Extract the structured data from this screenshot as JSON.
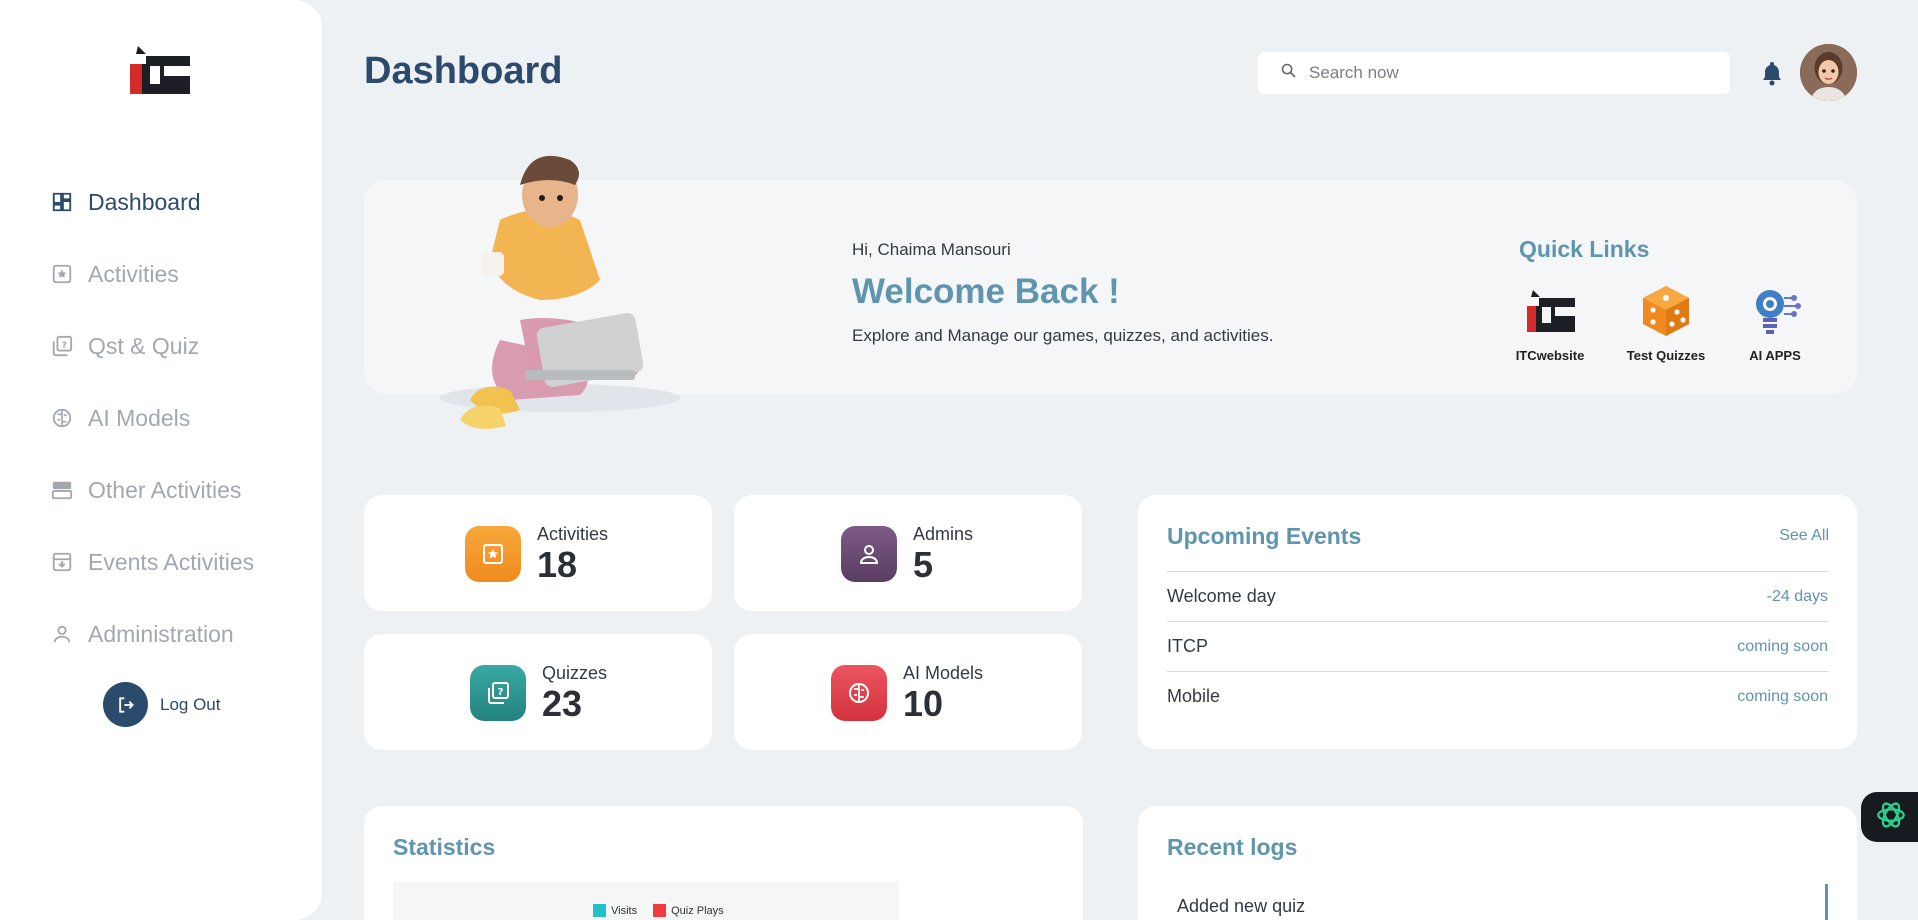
{
  "sidebar": {
    "items": [
      {
        "label": "Dashboard",
        "icon": "dashboard-icon",
        "active": true
      },
      {
        "label": "Activities",
        "icon": "star-box-icon"
      },
      {
        "label": "Qst & Quiz",
        "icon": "quiz-icon"
      },
      {
        "label": "AI Models",
        "icon": "brain-icon"
      },
      {
        "label": "Other Activities",
        "icon": "panels-icon"
      },
      {
        "label": "Events Activities",
        "icon": "archive-icon"
      },
      {
        "label": "Administration",
        "icon": "person-icon"
      }
    ],
    "logout_label": "Log Out"
  },
  "header": {
    "title": "Dashboard",
    "search_placeholder": "Search now"
  },
  "banner": {
    "greeting": "Hi, Chaima Mansouri",
    "welcome": "Welcome Back !",
    "subtitle": "Explore and Manage our games, quizzes, and activities.",
    "quick_links_title": "Quick Links",
    "quick_links": [
      {
        "label": "ITCwebsite",
        "icon": "itc-logo-icon"
      },
      {
        "label": "Test Quizzes",
        "icon": "dice-icon"
      },
      {
        "label": "AI APPS",
        "icon": "ai-bulb-icon"
      }
    ]
  },
  "stats": [
    {
      "label": "Activities",
      "value": "18",
      "color": "#f0962a"
    },
    {
      "label": "Admins",
      "value": "5",
      "color": "#6b4a72"
    },
    {
      "label": "Quizzes",
      "value": "23",
      "color": "#2e9a94"
    },
    {
      "label": "AI Models",
      "value": "10",
      "color": "#e0404a"
    }
  ],
  "events": {
    "title": "Upcoming Events",
    "see_all": "See All",
    "rows": [
      {
        "name": "Welcome day",
        "when": "-24 days"
      },
      {
        "name": "ITCP",
        "when": "coming soon"
      },
      {
        "name": "Mobile",
        "when": "coming soon"
      }
    ]
  },
  "statistics": {
    "title": "Statistics",
    "legend": [
      {
        "label": "Visits",
        "color": "#1fc2c8"
      },
      {
        "label": "Quiz Plays",
        "color": "#ef3b3b"
      }
    ]
  },
  "logs": {
    "title": "Recent logs",
    "items": [
      "Added new quiz"
    ]
  },
  "colors": {
    "primary": "#2c4a6b",
    "accent": "#5f95ad",
    "background": "#eef1f4"
  }
}
